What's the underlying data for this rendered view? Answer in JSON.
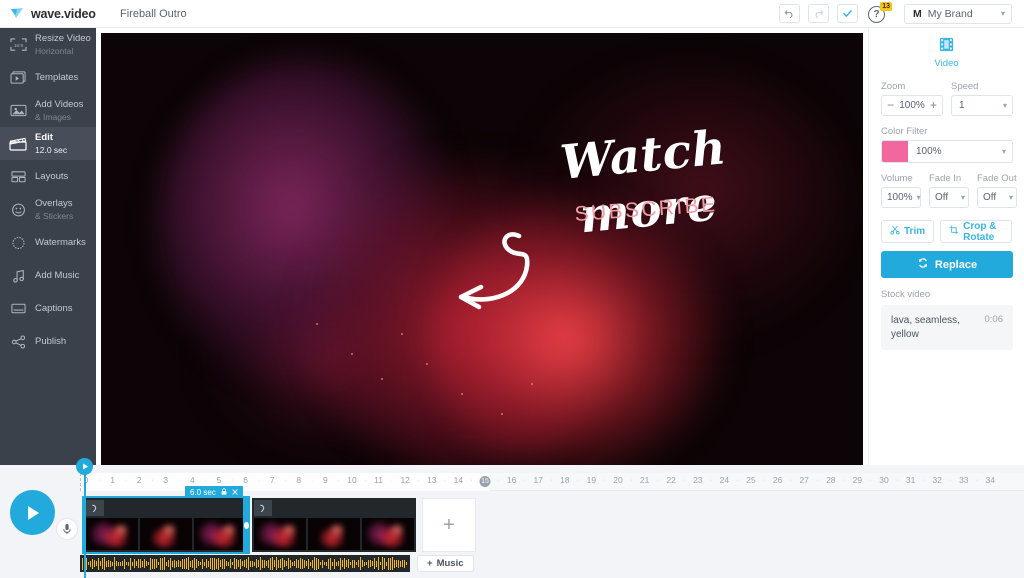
{
  "app": {
    "brand_name": "wave.video",
    "project_title": "Fireball Outro",
    "accent_blue": "#22aadc",
    "sidebar_bg": "#3b414b",
    "filter_pink": "#f2679d"
  },
  "topbar": {
    "undo_label": "undo-arrow",
    "redo_label": "redo-arrow",
    "confirm_label": "check",
    "help_label": "?",
    "help_badge": "13",
    "brand_initial": "M",
    "brand_selected": "My Brand"
  },
  "sidebar": {
    "items": [
      {
        "label": "Resize Video",
        "sub": "Horizontal",
        "icon": "aspect-ratio-icon",
        "active": false
      },
      {
        "label": "Templates",
        "sub": "",
        "icon": "templates-icon",
        "active": false
      },
      {
        "label": "Add Videos",
        "sub": "& Images",
        "icon": "image-icon",
        "active": false
      },
      {
        "label": "Edit",
        "sub": "12.0 sec",
        "icon": "clapperboard-icon",
        "active": true
      },
      {
        "label": "Layouts",
        "sub": "",
        "icon": "layouts-icon",
        "active": false
      },
      {
        "label": "Overlays",
        "sub": "& Stickers",
        "icon": "sticker-icon",
        "active": false
      },
      {
        "label": "Watermarks",
        "sub": "",
        "icon": "watermark-icon",
        "active": false
      },
      {
        "label": "Add Music",
        "sub": "",
        "icon": "music-note-icon",
        "active": false
      },
      {
        "label": "Captions",
        "sub": "",
        "icon": "captions-icon",
        "active": false
      },
      {
        "label": "Publish",
        "sub": "",
        "icon": "share-icon",
        "active": false
      }
    ]
  },
  "canvas": {
    "headline": "Watch more",
    "subline": "SUBSCRIBE"
  },
  "rightpanel": {
    "tab_label": "Video",
    "zoom_label": "Zoom",
    "zoom_value": "100%",
    "zoom_minus": "−",
    "zoom_plus": "+",
    "speed_label": "Speed",
    "speed_value": "1",
    "color_filter_label": "Color Filter",
    "color_filter_value": "100%",
    "volume_label": "Volume",
    "volume_value": "100%",
    "fade_in_label": "Fade In",
    "fade_in_value": "Off",
    "fade_out_label": "Fade Out",
    "fade_out_value": "Off",
    "trim_label": "Trim",
    "crop_label": "Crop & Rotate",
    "replace_label": "Replace",
    "stock_section_label": "Stock video",
    "stock_name": "lava, seamless, yellow",
    "stock_duration": "0:06"
  },
  "timeline": {
    "play_label": "play",
    "mic_label": "voiceover",
    "ruler_ticks": [
      "0",
      "1",
      "2",
      "3",
      "4",
      "5",
      "6",
      "7",
      "8",
      "9",
      "10",
      "11",
      "12",
      "13",
      "14",
      "15",
      "16",
      "17",
      "18",
      "19",
      "20",
      "21",
      "22",
      "23",
      "24",
      "25",
      "26",
      "27",
      "28",
      "29",
      "30",
      "31",
      "32",
      "33",
      "34"
    ],
    "playhead_tick": "15",
    "clip_badge_label": "6.0 sec",
    "clip_lock_icon": "lock-icon",
    "clip_close_icon": "close-icon",
    "clips": [
      {
        "name": "clip-1",
        "selected": true,
        "thumbs": 3
      },
      {
        "name": "clip-2",
        "selected": false,
        "thumbs": 3
      }
    ],
    "add_clip_label": "+",
    "music_button_label": "Music",
    "music_plus": "+"
  }
}
